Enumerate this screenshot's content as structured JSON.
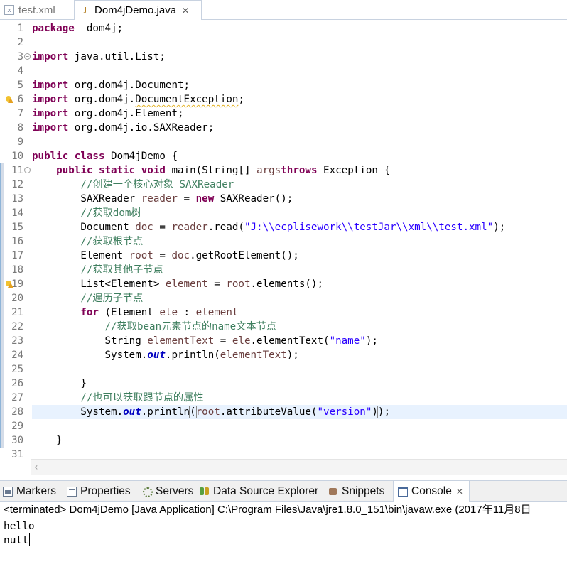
{
  "editor_tabs": [
    {
      "label": "test.xml",
      "icon": "xml-file-icon",
      "active": false
    },
    {
      "label": "Dom4jDemo.java",
      "icon": "java-file-icon",
      "active": true
    }
  ],
  "editor": {
    "current_line": 28,
    "warnings_on_lines": [
      6,
      19
    ],
    "fold_markers_on_lines": [
      3,
      11
    ],
    "changed_region_lines": [
      11,
      30
    ],
    "lines": [
      [
        [
          "kw",
          "package"
        ],
        [
          "",
          "  dom4j;"
        ]
      ],
      [],
      [
        [
          "kw",
          "import"
        ],
        [
          "",
          " java.util.List;"
        ]
      ],
      [],
      [
        [
          "kw",
          "import"
        ],
        [
          "",
          " org.dom4j.Document;"
        ]
      ],
      [
        [
          "kw",
          "import"
        ],
        [
          "",
          " org.dom4j."
        ],
        [
          "warnu",
          "DocumentException"
        ],
        [
          "",
          ";"
        ]
      ],
      [
        [
          "kw",
          "import"
        ],
        [
          "",
          " org.dom4j.Element;"
        ]
      ],
      [
        [
          "kw",
          "import"
        ],
        [
          "",
          " org.dom4j.io.SAXReader;"
        ]
      ],
      [],
      [
        [
          "kw",
          "public"
        ],
        [
          "",
          " "
        ],
        [
          "kw",
          "class"
        ],
        [
          "",
          " Dom4jDemo {"
        ]
      ],
      [
        [
          "",
          "    "
        ],
        [
          "kw",
          "public"
        ],
        [
          "",
          " "
        ],
        [
          "kw",
          "static"
        ],
        [
          "",
          " "
        ],
        [
          "kw",
          "void"
        ],
        [
          "",
          " main(String[] "
        ],
        [
          "fld",
          "args"
        ],
        [
          ") "
        ],
        [
          "kw",
          "throws"
        ],
        [
          "",
          " Exception {"
        ]
      ],
      [
        [
          "",
          "        "
        ],
        [
          "com",
          "//创建一个核心对象 SAXReader"
        ]
      ],
      [
        [
          "",
          "        SAXReader "
        ],
        [
          "fld",
          "reader"
        ],
        [
          "",
          " = "
        ],
        [
          "kw",
          "new"
        ],
        [
          "",
          " SAXReader();"
        ]
      ],
      [
        [
          "",
          "        "
        ],
        [
          "com",
          "//获取dom树"
        ]
      ],
      [
        [
          "",
          "        Document "
        ],
        [
          "fld",
          "doc"
        ],
        [
          "",
          " = "
        ],
        [
          "fld",
          "reader"
        ],
        [
          "",
          ".read("
        ],
        [
          "str",
          "\"J:\\\\ecplisework\\\\testJar\\\\xml\\\\test.xml\""
        ],
        [
          "",
          ");"
        ]
      ],
      [
        [
          "",
          "        "
        ],
        [
          "com",
          "//获取根节点"
        ]
      ],
      [
        [
          "",
          "        Element "
        ],
        [
          "fld",
          "root"
        ],
        [
          "",
          " = "
        ],
        [
          "fld",
          "doc"
        ],
        [
          "",
          ".getRootElement();"
        ]
      ],
      [
        [
          "",
          "        "
        ],
        [
          "com",
          "//获取其他子节点"
        ]
      ],
      [
        [
          "",
          "        List<Element> "
        ],
        [
          "fld",
          "element"
        ],
        [
          "",
          " = "
        ],
        [
          "fld",
          "root"
        ],
        [
          "",
          ".elements();"
        ]
      ],
      [
        [
          "",
          "        "
        ],
        [
          "com",
          "//遍历子节点"
        ]
      ],
      [
        [
          "",
          "        "
        ],
        [
          "kw",
          "for"
        ],
        [
          "",
          " (Element "
        ],
        [
          "fld",
          "ele"
        ],
        [
          "",
          " : "
        ],
        [
          "fld",
          "element"
        ],
        [
          ") {"
        ]
      ],
      [
        [
          "",
          "            "
        ],
        [
          "com",
          "//获取bean元素节点的name文本节点"
        ]
      ],
      [
        [
          "",
          "            String "
        ],
        [
          "fld",
          "elementText"
        ],
        [
          "",
          " = "
        ],
        [
          "fld",
          "ele"
        ],
        [
          "",
          ".elementText("
        ],
        [
          "str",
          "\"name\""
        ],
        [
          "",
          ");"
        ]
      ],
      [
        [
          "",
          "            System."
        ],
        [
          "sfld",
          "out"
        ],
        [
          "",
          ".println("
        ],
        [
          "fld",
          "elementText"
        ],
        [
          "",
          ");"
        ]
      ],
      [],
      [
        [
          "",
          "        }"
        ]
      ],
      [
        [
          "",
          "        "
        ],
        [
          "com",
          "//也可以获取跟节点的属性"
        ]
      ],
      [
        [
          "",
          "        System."
        ],
        [
          "sfld",
          "out"
        ],
        [
          "",
          ".println"
        ],
        [
          "bm",
          "("
        ],
        [
          "fld",
          "root"
        ],
        [
          "",
          ".attributeValue("
        ],
        [
          "str",
          "\"version\""
        ],
        [
          "",
          ")"
        ],
        [
          "bm",
          ")"
        ],
        [
          "",
          ";"
        ]
      ],
      [],
      [
        [
          "",
          "    }"
        ]
      ],
      []
    ]
  },
  "panel_tabs": [
    {
      "label": "Markers",
      "icon": "markers-icon"
    },
    {
      "label": "Properties",
      "icon": "properties-icon"
    },
    {
      "label": "Servers",
      "icon": "servers-icon"
    },
    {
      "label": "Data Source Explorer",
      "icon": "data-source-explorer-icon"
    },
    {
      "label": "Snippets",
      "icon": "snippets-icon"
    },
    {
      "label": "Console",
      "icon": "console-icon",
      "active": true
    }
  ],
  "console": {
    "status": "<terminated> Dom4jDemo [Java Application] C:\\Program Files\\Java\\jre1.8.0_151\\bin\\javaw.exe (2017年11月8日",
    "output_lines": [
      "hello",
      "null"
    ]
  },
  "colors": {
    "keyword": "#7f0055",
    "string": "#2a00ff",
    "comment": "#3f7f5f",
    "field": "#6a3e3e",
    "static_field": "#0000c0",
    "current_line_bg": "#e8f2fe"
  }
}
